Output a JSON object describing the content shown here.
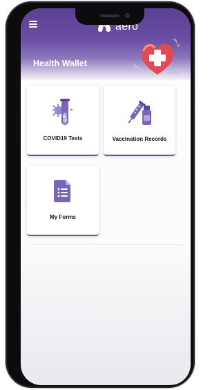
{
  "app": {
    "brand": "aero",
    "page_title": "Health Wallet"
  },
  "cards": [
    {
      "label": "COVID19 Tests",
      "icon": "test-tube-virus-icon"
    },
    {
      "label": "Vaccination Records",
      "icon": "syringe-vial-icon"
    },
    {
      "label": "My Forms",
      "icon": "document-list-icon"
    }
  ],
  "colors": {
    "header_top": "#5b3f93",
    "accent": "#6b55a8",
    "icon_purple": "#7b65b8",
    "heart_red": "#e04a55"
  }
}
